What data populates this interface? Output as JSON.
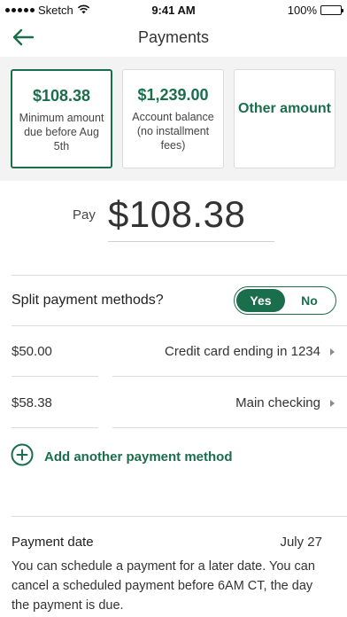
{
  "status_bar": {
    "carrier": "Sketch",
    "time": "9:41 AM",
    "battery": "100%"
  },
  "nav": {
    "title": "Payments",
    "back_icon": "arrow-left-icon"
  },
  "options": [
    {
      "amount": "$108.38",
      "description": "Minimum amount due before Aug 5th",
      "selected": true
    },
    {
      "amount": "$1,239.00",
      "description": "Account balance (no installment fees)",
      "selected": false
    },
    {
      "label": "Other amount",
      "selected": false
    }
  ],
  "pay": {
    "label": "Pay",
    "amount": "$108.38"
  },
  "split": {
    "label": "Split payment methods?",
    "yes": "Yes",
    "no": "No",
    "selected": "Yes"
  },
  "methods": [
    {
      "amount": "$50.00",
      "name": "Credit card ending in 1234"
    },
    {
      "amount": "$58.38",
      "name": "Main checking"
    }
  ],
  "add_method": {
    "label": "Add another payment method",
    "icon": "plus-circle-icon"
  },
  "payment_date": {
    "label": "Payment date",
    "value": "July 27",
    "help": "You can schedule a payment for a later date. You can cancel a scheduled payment before 6AM CT, the day the payment is due."
  },
  "colors": {
    "accent": "#1b6e4b",
    "card_background": "#f3f3f3",
    "divider": "#dcdcdc"
  }
}
